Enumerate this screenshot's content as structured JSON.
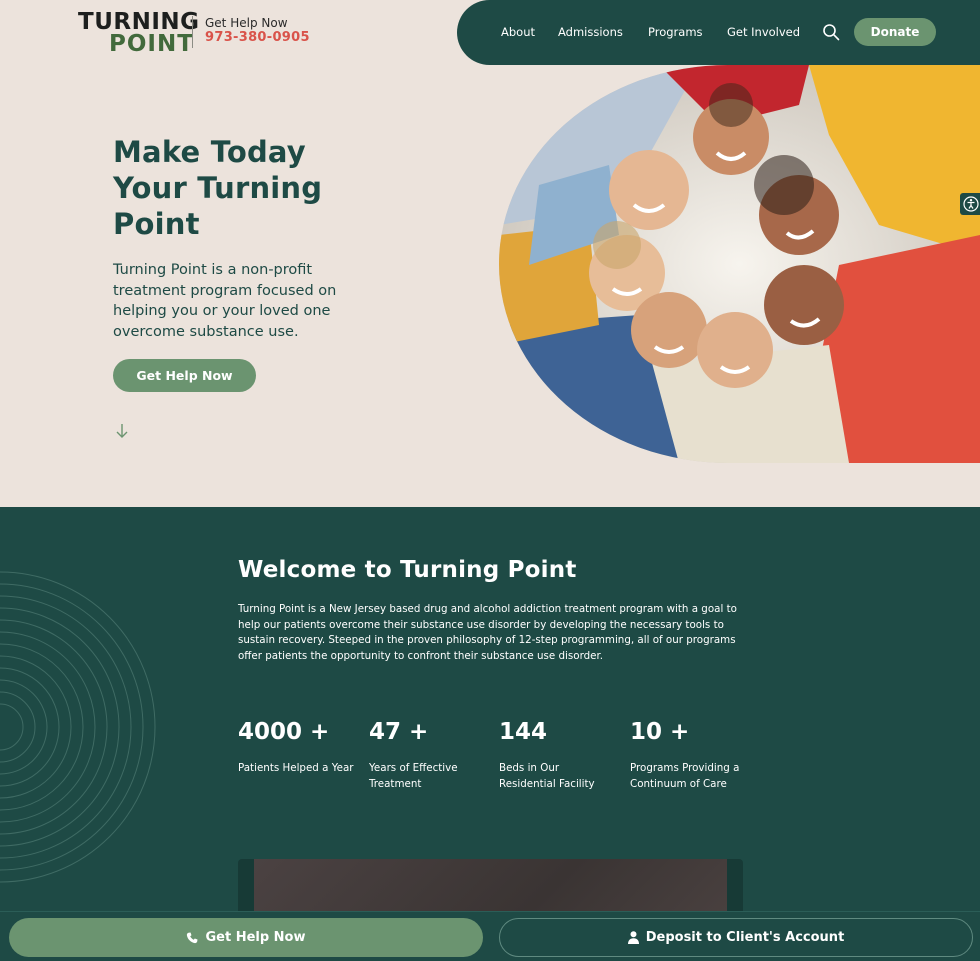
{
  "header": {
    "logo_top": "TURNING",
    "logo_bottom": "POINT",
    "help_label": "Get Help Now",
    "help_phone": "973-380-0905",
    "nav": [
      "About",
      "Admissions",
      "Programs",
      "Get Involved"
    ],
    "search_icon": "search-icon",
    "donate_label": "Donate"
  },
  "hero": {
    "title_lines": [
      "Make Today",
      "Your Turning",
      "Point"
    ],
    "description": "Turning Point is a non-profit treatment program focused on helping you or your loved one overcome substance use.",
    "cta_label": "Get Help Now",
    "scroll_icon": "arrow-down-icon",
    "accessibility_icon": "accessibility-icon"
  },
  "welcome": {
    "title": "Welcome to Turning Point",
    "text": "Turning Point is a New Jersey based drug and alcohol addiction treatment program with a goal to help our patients overcome their substance use disorder by developing the necessary tools to sustain recovery. Steeped in the proven philosophy of 12-step programming, all of our programs offer patients the opportunity to confront their substance use disorder.",
    "stats": [
      {
        "number": "4000 +",
        "label": "Patients Helped a Year"
      },
      {
        "number": "47 +",
        "label": "Years of Effective Treatment"
      },
      {
        "number": "144",
        "label": "Beds in Our Residential Facility"
      },
      {
        "number": "10 +",
        "label": "Programs Providing a Continuum of Care"
      }
    ]
  },
  "bottom_bar": {
    "help_label": "Get Help Now",
    "help_icon": "phone-icon",
    "deposit_label": "Deposit to Client's Account",
    "deposit_icon": "user-icon"
  },
  "colors": {
    "background": "#ece3dc",
    "primary_green": "#1e4a45",
    "accent_green": "#6b9470",
    "phone_red": "#d9534a"
  }
}
